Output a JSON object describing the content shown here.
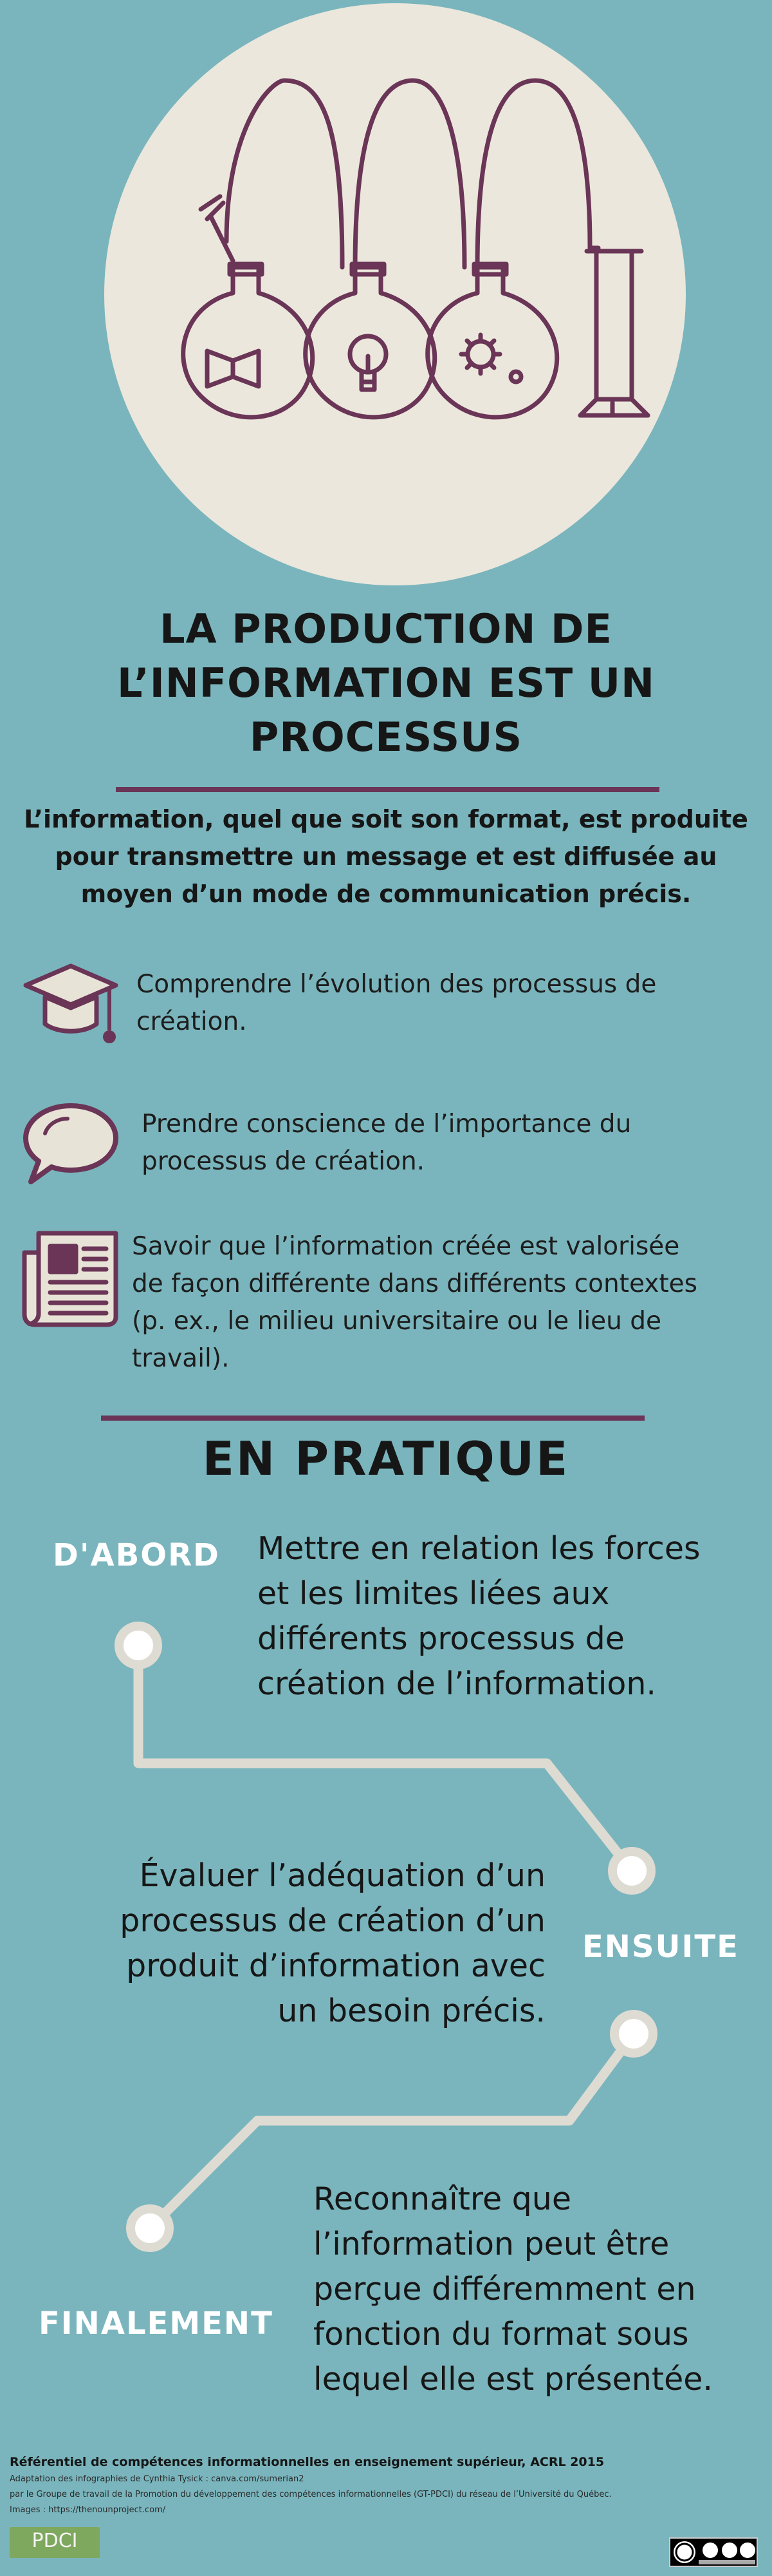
{
  "title": {
    "line1": "LA PRODUCTION DE",
    "line2": "L’INFORMATION EST UN",
    "line3": "PROCESSUS"
  },
  "intro": {
    "line1": "L’information, quel que soit son format, est produite",
    "line2": "pour transmettre un message et est diffusée au",
    "line3": "moyen d’un mode de communication précis."
  },
  "objectives": [
    {
      "icon": "graduation-cap-icon",
      "lines": [
        "Comprendre l’évolution des processus de",
        "création."
      ]
    },
    {
      "icon": "speech-bubble-icon",
      "lines": [
        "Prendre conscience de l’importance du",
        "processus de création."
      ]
    },
    {
      "icon": "newspaper-icon",
      "lines": [
        "Savoir que l’information créée est valorisée",
        "de façon différente dans différents contextes",
        "(p. ex., le milieu universitaire ou le lieu de",
        "travail)."
      ]
    }
  ],
  "practice": {
    "title": "EN PRATIQUE",
    "steps": [
      {
        "label": "D'ABORD",
        "lines": [
          "Mettre en relation les forces",
          "et les limites liées aux",
          "différents processus de",
          "création de  l’information."
        ]
      },
      {
        "label": "ENSUITE",
        "lines": [
          "Évaluer l’adéquation d’un",
          "processus de création d’un",
          "produit d’information avec",
          "un besoin précis."
        ]
      },
      {
        "label": "FINALEMENT",
        "lines": [
          "Reconnaître que",
          "l’information peut être",
          "perçue différemment en",
          "fonction du format sous",
          "lequel elle est présentée."
        ]
      }
    ]
  },
  "footer": {
    "reference": "Référentiel de compétences informationnelles en enseignement supérieur, ACRL 2015",
    "adaptation": "Adaptation des infographies de Cynthia Tysick : canva.com/sumerian2",
    "group": "par le Groupe de travail de la Promotion du développement des compétences informationnelles (GT-PDCI) du réseau de l’Université du Québec.",
    "images": "Images : https://thenounproject.com/",
    "logo": "PDCI"
  },
  "colors": {
    "background": "#7ab5bd",
    "circle": "#ebe7dc",
    "accent": "#6a3556",
    "path": "#dedbd3"
  }
}
